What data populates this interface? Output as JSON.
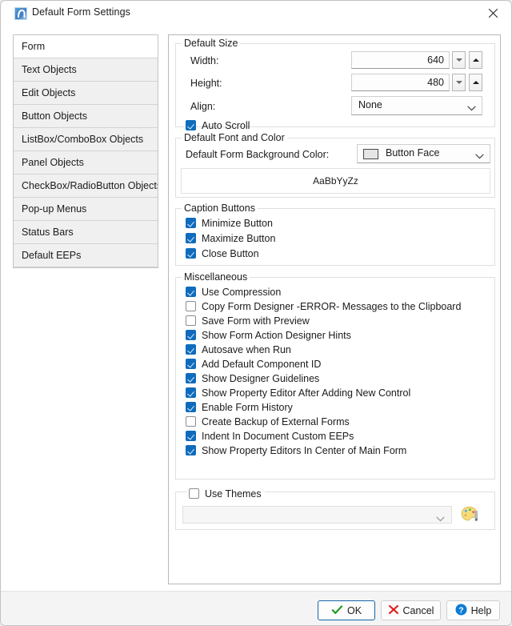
{
  "window": {
    "title": "Default Form Settings",
    "icon": "form-app-icon",
    "close_icon": "close-icon"
  },
  "sidebar": {
    "selected_index": 0,
    "items": [
      {
        "label": "Form"
      },
      {
        "label": "Text Objects"
      },
      {
        "label": "Edit Objects"
      },
      {
        "label": "Button Objects"
      },
      {
        "label": "ListBox/ComboBox Objects"
      },
      {
        "label": "Panel Objects"
      },
      {
        "label": "CheckBox/RadioButton Objects"
      },
      {
        "label": "Pop-up Menus"
      },
      {
        "label": "Status Bars"
      },
      {
        "label": "Default EEPs"
      }
    ]
  },
  "groups": {
    "default_size": {
      "title": "Default Size",
      "width_label": "Width:",
      "width_value": "640",
      "height_label": "Height:",
      "height_value": "480",
      "align_label": "Align:",
      "align_value": "None",
      "auto_scroll": {
        "label": "Auto Scroll",
        "checked": true
      },
      "spin_down_icon": "chevron-down-icon",
      "spin_up_icon": "chevron-up-icon"
    },
    "default_font_color": {
      "title": "Default Font and Color",
      "bg_color_label": "Default Form Background Color:",
      "bg_color_value": "Button Face",
      "bg_color_swatch": "#e6e6e6",
      "font_preview_text": "AaBbYyZz",
      "chevron_icon": "chevron-down-icon"
    },
    "caption_buttons": {
      "title": "Caption Buttons",
      "items": [
        {
          "label": "Minimize Button",
          "checked": true
        },
        {
          "label": "Maximize Button",
          "checked": true
        },
        {
          "label": "Close Button",
          "checked": true
        }
      ]
    },
    "miscellaneous": {
      "title": "Miscellaneous",
      "items": [
        {
          "label": "Use Compression",
          "checked": true
        },
        {
          "label": "Copy Form Designer -ERROR- Messages to the Clipboard",
          "checked": false
        },
        {
          "label": "Save Form with Preview",
          "checked": false
        },
        {
          "label": "Show Form Action Designer Hints",
          "checked": true
        },
        {
          "label": "Autosave when Run",
          "checked": true
        },
        {
          "label": "Add Default Component ID",
          "checked": true
        },
        {
          "label": "Show Designer Guidelines",
          "checked": true
        },
        {
          "label": "Show Property Editor After Adding New Control",
          "checked": true
        },
        {
          "label": "Enable Form History",
          "checked": true
        },
        {
          "label": "Create Backup of External Forms",
          "checked": false
        },
        {
          "label": "Indent In Document Custom EEPs",
          "checked": true
        },
        {
          "label": "Show Property Editors In Center of Main Form",
          "checked": true
        }
      ]
    },
    "themes": {
      "title_checkbox": {
        "label": "Use Themes",
        "checked": false
      },
      "theme_value": "",
      "theme_placeholder": "",
      "chevron_icon": "chevron-down-icon",
      "palette_icon": "color-palette-icon"
    }
  },
  "footer": {
    "ok_label": "OK",
    "ok_icon": "checkmark-icon",
    "cancel_label": "Cancel",
    "cancel_icon": "x-mark-icon",
    "help_label": "Help",
    "help_icon": "question-circle-icon"
  },
  "colors": {
    "accent": "#0f6cbd",
    "ok_check": "#1a9a1a",
    "cancel_x": "#e01b1b",
    "help_blue": "#0b7bd4",
    "default_border": "#1565a8"
  }
}
